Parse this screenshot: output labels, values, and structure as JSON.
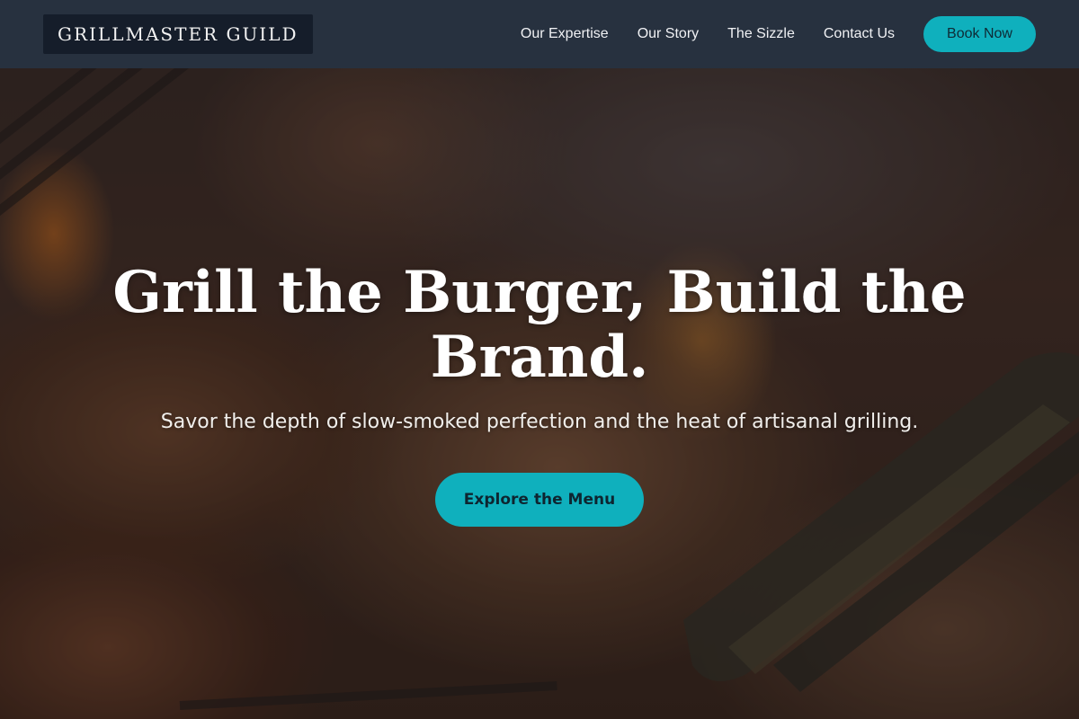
{
  "header": {
    "logo_text": "GRILLMASTER GUILD",
    "nav": [
      {
        "label": "Our Expertise"
      },
      {
        "label": "Our Story"
      },
      {
        "label": "The Sizzle"
      },
      {
        "label": "Contact Us"
      }
    ],
    "book_label": "Book Now"
  },
  "hero": {
    "title": "Grill the Burger, Build the Brand.",
    "subtitle": "Savor the depth of slow-smoked perfection and the heat of artisanal grilling.",
    "cta_label": "Explore the Menu"
  },
  "colors": {
    "header_bg": "#27313f",
    "logo_bg": "#151d2a",
    "accent": "#0fb0bd"
  }
}
